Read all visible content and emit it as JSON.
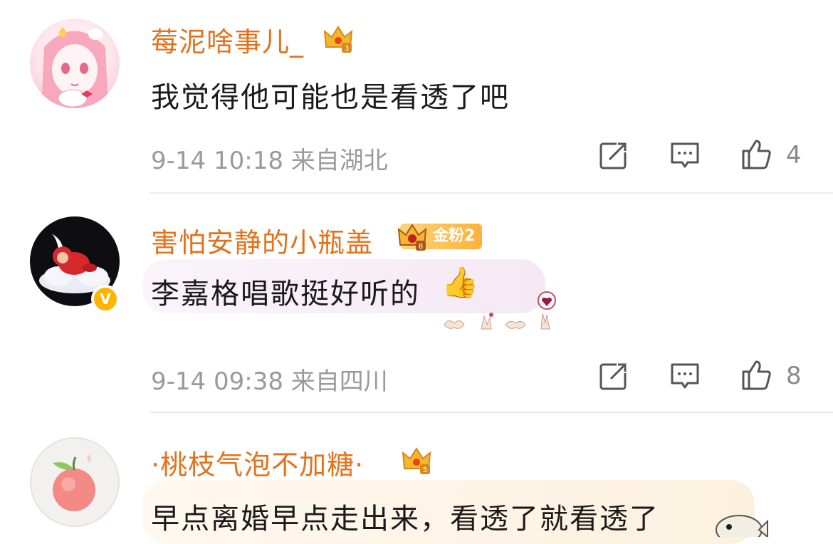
{
  "comments": [
    {
      "username": "莓泥啥事儿_",
      "text": "我觉得他可能也是看透了吧",
      "meta": "9-14 10:18 来自湖北",
      "likes": "4",
      "level": "3",
      "verified": false
    },
    {
      "username": "害怕安静的小瓶盖",
      "text": "李嘉格唱歌挺好听的",
      "emoji": "👍",
      "meta": "9-14 09:38 来自四川",
      "likes": "8",
      "level": "8",
      "fan_badge": "金粉2",
      "verified": true,
      "verified_mark": "V"
    },
    {
      "username": "·桃枝气泡不加糖·",
      "text": "早点离婚早点走出来，看透了就看透了",
      "level": "5",
      "verified": false
    }
  ],
  "icons": {
    "share": "share-icon",
    "comment": "comment-icon",
    "like": "thumbs-up-icon",
    "crown": "crown-icon"
  },
  "colors": {
    "username": "#e4711a",
    "meta": "#9a9a9a",
    "text": "#1a1a1a"
  }
}
